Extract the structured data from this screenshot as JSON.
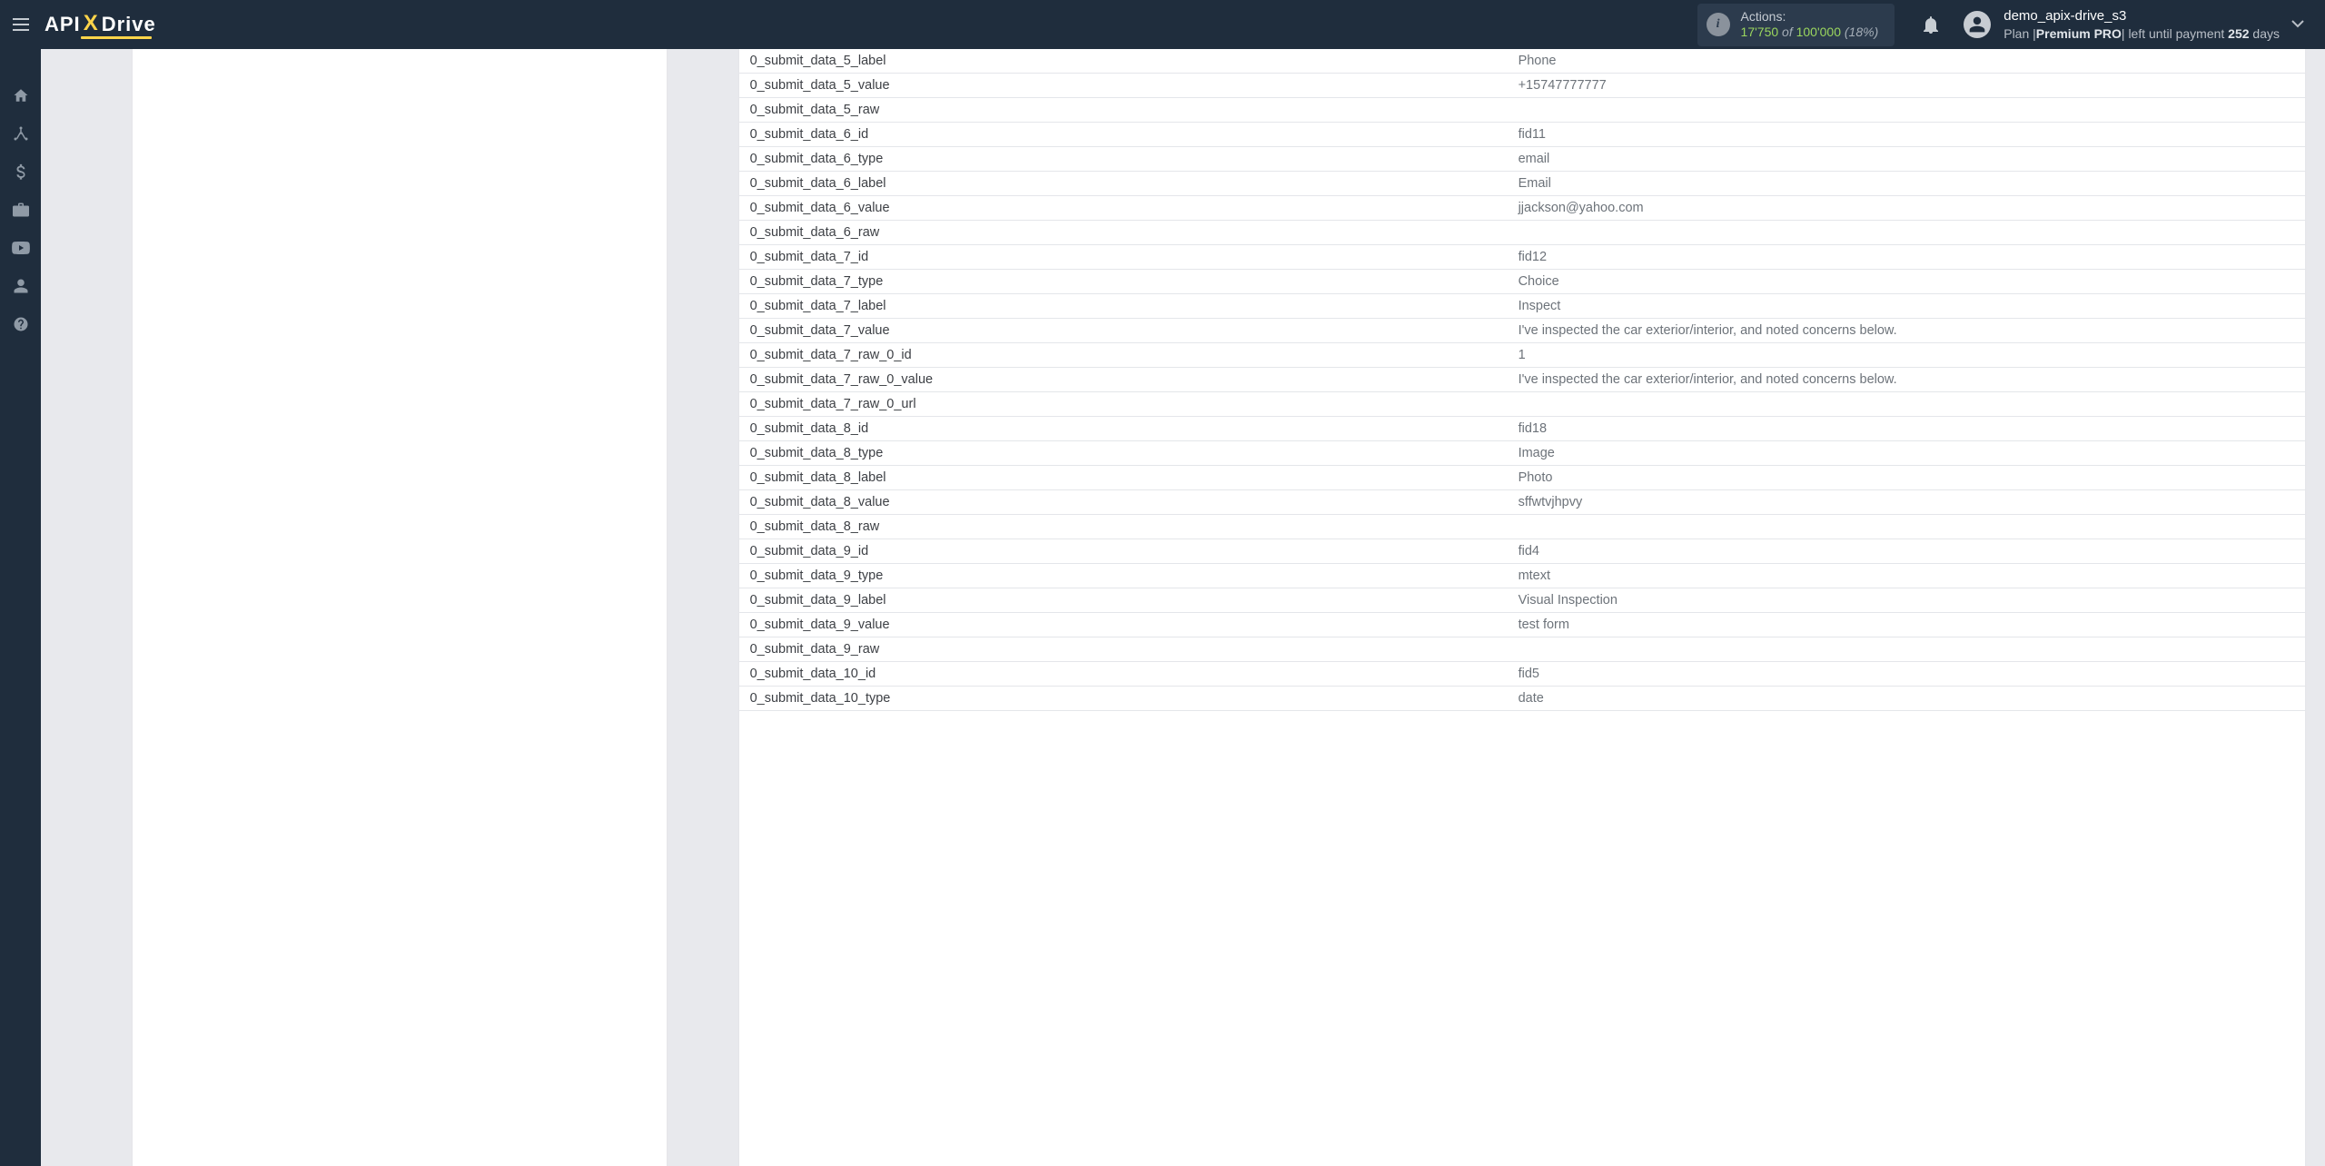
{
  "logo": {
    "api": "API",
    "x": "X",
    "drive": "Drive"
  },
  "header": {
    "actions_label": "Actions:",
    "actions_count": "17'750",
    "actions_of": " of ",
    "actions_total": "100'000",
    "actions_pct": " (18%)"
  },
  "user": {
    "name": "demo_apix-drive_s3",
    "plan_prefix": "Plan |",
    "plan_name": "Premium PRO",
    "plan_mid": "| left until payment ",
    "plan_days_num": "252",
    "plan_days_word": " days"
  },
  "sidebar": {
    "items": [
      {
        "name": "home"
      },
      {
        "name": "connections"
      },
      {
        "name": "billing"
      },
      {
        "name": "briefcase"
      },
      {
        "name": "video"
      },
      {
        "name": "profile"
      },
      {
        "name": "help"
      }
    ]
  },
  "rows": [
    {
      "k": "0_submit_data_5_label",
      "v": "Phone"
    },
    {
      "k": "0_submit_data_5_value",
      "v": "+15747777777"
    },
    {
      "k": "0_submit_data_5_raw",
      "v": ""
    },
    {
      "k": "0_submit_data_6_id",
      "v": "fid11"
    },
    {
      "k": "0_submit_data_6_type",
      "v": "email"
    },
    {
      "k": "0_submit_data_6_label",
      "v": "Email"
    },
    {
      "k": "0_submit_data_6_value",
      "v": "jjackson@yahoo.com"
    },
    {
      "k": "0_submit_data_6_raw",
      "v": ""
    },
    {
      "k": "0_submit_data_7_id",
      "v": "fid12"
    },
    {
      "k": "0_submit_data_7_type",
      "v": "Choice"
    },
    {
      "k": "0_submit_data_7_label",
      "v": "Inspect"
    },
    {
      "k": "0_submit_data_7_value",
      "v": "I've inspected the car exterior/interior, and noted concerns below."
    },
    {
      "k": "0_submit_data_7_raw_0_id",
      "v": "1"
    },
    {
      "k": "0_submit_data_7_raw_0_value",
      "v": "I've inspected the car exterior/interior, and noted concerns below."
    },
    {
      "k": "0_submit_data_7_raw_0_url",
      "v": ""
    },
    {
      "k": "0_submit_data_8_id",
      "v": "fid18"
    },
    {
      "k": "0_submit_data_8_type",
      "v": "Image"
    },
    {
      "k": "0_submit_data_8_label",
      "v": "Photo"
    },
    {
      "k": "0_submit_data_8_value",
      "v": "sffwtvjhpvy"
    },
    {
      "k": "0_submit_data_8_raw",
      "v": ""
    },
    {
      "k": "0_submit_data_9_id",
      "v": "fid4"
    },
    {
      "k": "0_submit_data_9_type",
      "v": "mtext"
    },
    {
      "k": "0_submit_data_9_label",
      "v": "Visual Inspection"
    },
    {
      "k": "0_submit_data_9_value",
      "v": "test form"
    },
    {
      "k": "0_submit_data_9_raw",
      "v": ""
    },
    {
      "k": "0_submit_data_10_id",
      "v": "fid5"
    },
    {
      "k": "0_submit_data_10_type",
      "v": "date"
    }
  ]
}
